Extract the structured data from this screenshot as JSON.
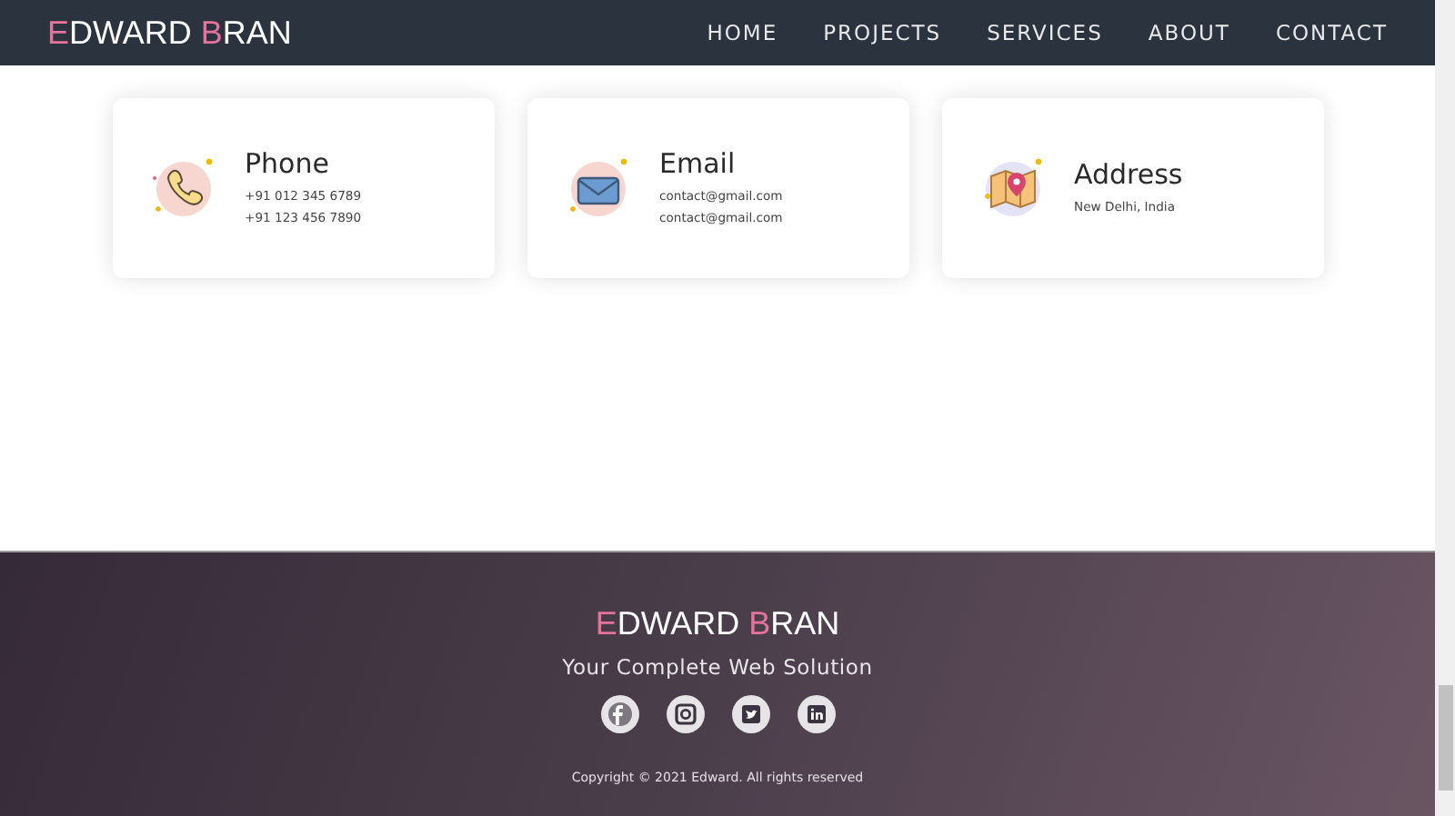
{
  "navbar": {
    "logo": [
      {
        "text": "E",
        "accent": true
      },
      {
        "text": "DWARD ",
        "accent": false
      },
      {
        "text": "B",
        "accent": true
      },
      {
        "text": "RAN",
        "accent": false
      }
    ],
    "links": [
      {
        "label": "HOME"
      },
      {
        "label": "PROJECTS"
      },
      {
        "label": "SERVICES"
      },
      {
        "label": "ABOUT"
      },
      {
        "label": "CONTACT"
      }
    ]
  },
  "contact_cards": [
    {
      "kind": "phone",
      "title": "Phone",
      "lines": [
        "+91 012 345 6789",
        "+91 123 456 7890"
      ]
    },
    {
      "kind": "email",
      "title": "Email",
      "lines": [
        "contact@gmail.com",
        "contact@gmail.com"
      ]
    },
    {
      "kind": "address",
      "title": "Address",
      "lines": [
        "New Delhi, India"
      ]
    }
  ],
  "footer": {
    "logo": [
      {
        "text": "E",
        "accent": true
      },
      {
        "text": "DWARD ",
        "accent": false
      },
      {
        "text": "B",
        "accent": true
      },
      {
        "text": "RAN",
        "accent": false
      }
    ],
    "tagline": "Your Complete Web Solution",
    "social": [
      {
        "kind": "facebook"
      },
      {
        "kind": "instagram"
      },
      {
        "kind": "twitter"
      },
      {
        "kind": "linkedin"
      }
    ],
    "copyright": "Copyright © 2021 Edward. All rights reserved"
  }
}
